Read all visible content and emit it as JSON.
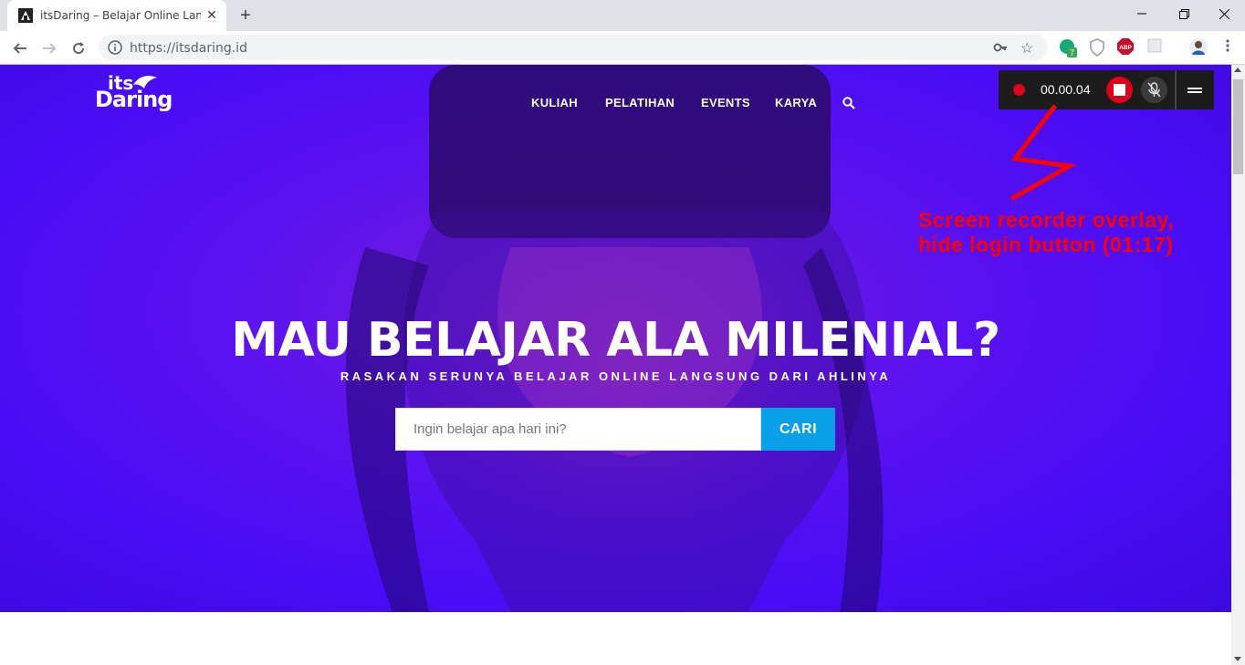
{
  "browser": {
    "tab": {
      "title": "itsDaring – Belajar Online Langsung",
      "close_icon": "close-icon"
    },
    "new_tab_label": "+",
    "window_controls": [
      "minimize-icon",
      "restore-icon",
      "close-icon"
    ],
    "address": {
      "url": "https://itsdaring.id"
    },
    "extensions": [
      {
        "icon": "grammarly-icon",
        "badge": "7"
      },
      {
        "icon": "shield-extension-icon"
      },
      {
        "icon": "adblock-icon",
        "label": "ABP"
      },
      {
        "icon": "extension-icon"
      },
      {
        "icon": "profile-avatar-icon"
      }
    ]
  },
  "site": {
    "logo": {
      "its": "its",
      "daring": "Daring"
    },
    "nav": [
      "KULIAH",
      "PELATIHAN",
      "EVENTS",
      "KARYA"
    ],
    "headline": "MAU BELAJAR ALA MILENIAL?",
    "subline": "RASAKAN SERUNYA BELAJAR ONLINE LANGSUNG DARI AHLINYA",
    "search": {
      "placeholder": "Ingin belajar apa hari ini?",
      "button": "CARI"
    }
  },
  "recorder": {
    "time": "00.00.04"
  },
  "annotation": {
    "line1": "Screen recorder overlay,",
    "line2": "hide login button (01:17)"
  },
  "colors": {
    "hero_purple": "#4a0cf5",
    "cari_blue": "#0aa0e8",
    "record_red": "#e0001b",
    "annotation_red": "#ff0000"
  }
}
